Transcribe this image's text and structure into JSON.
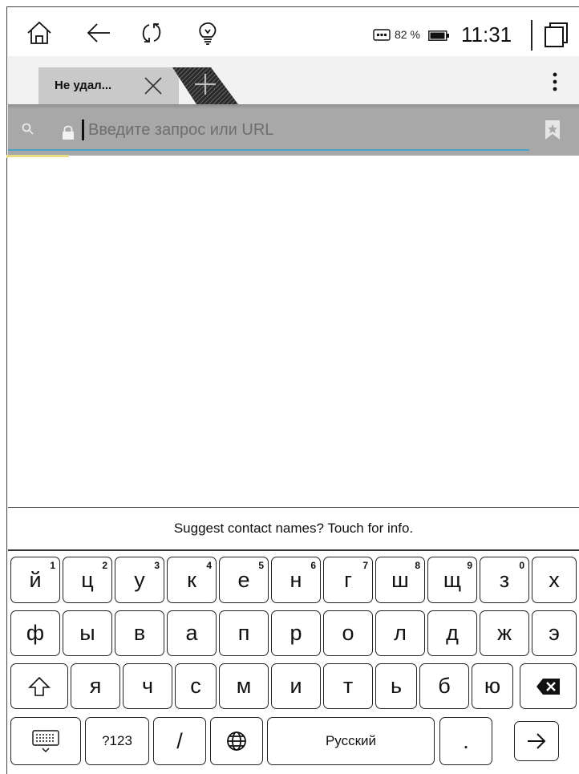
{
  "status_bar": {
    "battery_percent": "82 %",
    "time": "11:31"
  },
  "tabs": [
    {
      "title": "Не удал..."
    }
  ],
  "address_bar": {
    "placeholder": "Введите запрос или URL",
    "value": ""
  },
  "suggestion": {
    "text": "Suggest contact names? Touch for info."
  },
  "keyboard": {
    "row1": [
      {
        "label": "й",
        "hint": "1"
      },
      {
        "label": "ц",
        "hint": "2"
      },
      {
        "label": "у",
        "hint": "3"
      },
      {
        "label": "к",
        "hint": "4"
      },
      {
        "label": "е",
        "hint": "5"
      },
      {
        "label": "н",
        "hint": "6"
      },
      {
        "label": "г",
        "hint": "7"
      },
      {
        "label": "ш",
        "hint": "8"
      },
      {
        "label": "щ",
        "hint": "9"
      },
      {
        "label": "з",
        "hint": "0"
      },
      {
        "label": "х",
        "hint": ""
      }
    ],
    "row2": [
      "ф",
      "ы",
      "в",
      "а",
      "п",
      "р",
      "о",
      "л",
      "д",
      "ж",
      "э"
    ],
    "row3": [
      "я",
      "ч",
      "с",
      "м",
      "и",
      "т",
      "ь",
      "б",
      "ю"
    ],
    "symbols_label": "?123",
    "slash_label": "/",
    "space_label": "Русский",
    "period_label": "."
  }
}
